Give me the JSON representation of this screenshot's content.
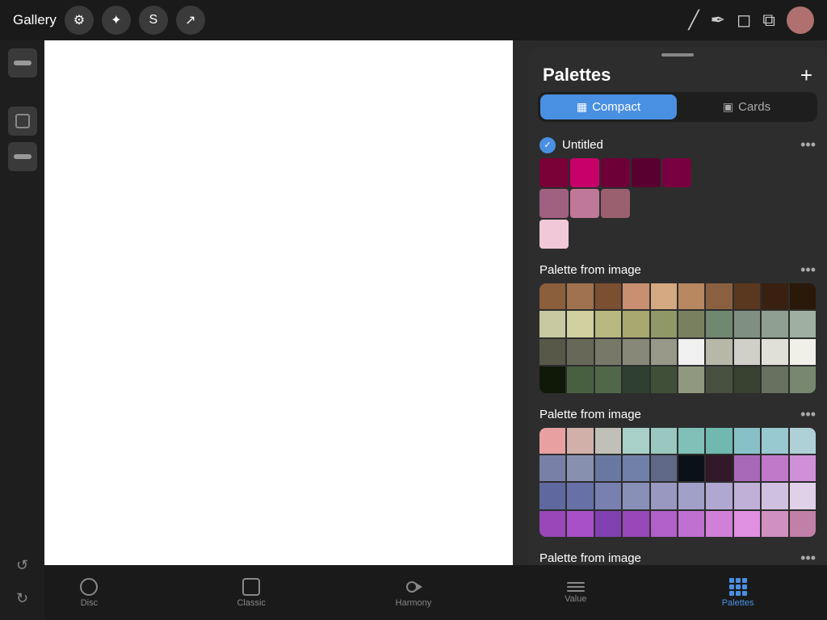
{
  "app": {
    "gallery_label": "Gallery"
  },
  "toolbar": {
    "tools": [
      "⚙",
      "✦",
      "S",
      "↗"
    ]
  },
  "palettes_panel": {
    "title": "Palettes",
    "add_button": "+",
    "drag_handle": true,
    "tabs": [
      {
        "id": "compact",
        "label": "Compact",
        "icon": "▦",
        "active": true
      },
      {
        "id": "cards",
        "label": "Cards",
        "icon": "▣",
        "active": false
      }
    ],
    "palettes": [
      {
        "id": "untitled",
        "name": "Untitled",
        "checked": true,
        "swatches": [
          "#7a0038",
          "#c8006a",
          "#6e0038",
          "#5a0030",
          "#790040",
          "#000000",
          "#000000",
          "#000000",
          "#000000",
          "#000000",
          "#a06080",
          "#c07898",
          "#9a6070",
          "#000000",
          "#000000",
          "#000000",
          "#000000",
          "#000000",
          "#000000",
          "#000000",
          "#e8b0c8",
          "#000000",
          "#000000",
          "#000000",
          "#000000",
          "#000000",
          "#000000",
          "#000000",
          "#000000",
          "#000000"
        ],
        "visible_swatches": [
          "#7a0038",
          "#c8006a",
          "#6e0038",
          "#a06080",
          "#c07898",
          "#9a6070",
          "#f0c8d8",
          "#000000",
          "#000000"
        ]
      },
      {
        "id": "palette-image-1",
        "name": "Palette from image",
        "checked": false,
        "swatches": [
          "#8b5e3c",
          "#a0714f",
          "#7a5030",
          "#c89070",
          "#d4a880",
          "#b88860",
          "#8a6040",
          "#5a3820",
          "#3a2010",
          "#2a1808",
          "#c8c8a0",
          "#d8d8a8",
          "#b8b888",
          "#a8a870",
          "#909868",
          "#788060",
          "#606850",
          "#485040",
          "#304030",
          "#1e2820",
          "#585848",
          "#686858",
          "#787868",
          "#888878",
          "#989888",
          "#a8a898",
          "#b8b8a8",
          "#c8c8b8",
          "#d8d8c8",
          "#e8e8d8",
          "#202818",
          "#283020",
          "#304028",
          "#384830",
          "#405038",
          "#486040",
          "#506848",
          "#587050",
          "#687860",
          "#788870"
        ]
      },
      {
        "id": "palette-image-2",
        "name": "Palette from image",
        "checked": false,
        "swatches": [
          "#e8a0a0",
          "#d0b0a8",
          "#c0c0b8",
          "#a8d0c8",
          "#98c8c0",
          "#80c0b8",
          "#70b8b0",
          "#88c0c8",
          "#98c8d0",
          "#b0d0d8",
          "#7880a8",
          "#8890b0",
          "#6878a0",
          "#7080a8",
          "#606888",
          "#182030",
          "#301828",
          "#a868b8",
          "#c078c8",
          "#d090d8",
          "#6068a0",
          "#6870a8",
          "#7880b0",
          "#8890b8",
          "#9898c0",
          "#a0a0c8",
          "#b0a8d0",
          "#c0b0d8",
          "#d0c0e0",
          "#e0d0e8",
          "#9848b8",
          "#a850c8",
          "#8040b0",
          "#9848b8",
          "#b060c8",
          "#c070d0",
          "#d080d8",
          "#e090e0",
          "#d090c0",
          "#c080a8"
        ]
      }
    ]
  },
  "bottom_nav": {
    "items": [
      {
        "id": "disc",
        "label": "Disc",
        "active": false
      },
      {
        "id": "classic",
        "label": "Classic",
        "active": false
      },
      {
        "id": "harmony",
        "label": "Harmony",
        "active": false
      },
      {
        "id": "value",
        "label": "Value",
        "active": false
      },
      {
        "id": "palettes",
        "label": "Palettes",
        "active": true
      }
    ]
  }
}
